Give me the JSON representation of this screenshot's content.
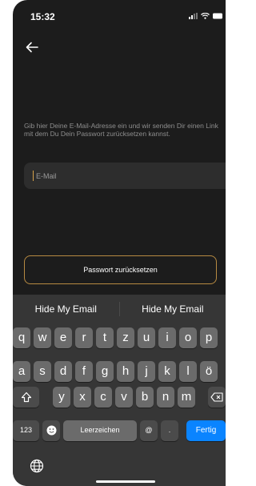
{
  "status_bar": {
    "time": "15:32"
  },
  "screen": {
    "description": "Gib hier Deine E-Mail-Adresse ein und wir senden Dir einen Link mit dem Du Dein Passwort zurücksetzen kannst.",
    "email_placeholder": "E-Mail",
    "reset_button_label": "Passwort zurücksetzen"
  },
  "keyboard": {
    "suggestions": [
      "Hide My Email",
      "Hide My Email"
    ],
    "row1": [
      "q",
      "w",
      "e",
      "r",
      "t",
      "z",
      "u",
      "i",
      "o",
      "p"
    ],
    "row2": [
      "a",
      "s",
      "d",
      "f",
      "g",
      "h",
      "j",
      "k",
      "l",
      "ö"
    ],
    "row3": [
      "y",
      "x",
      "c",
      "v",
      "b",
      "n",
      "m"
    ],
    "numbers_key": "123",
    "space_label": "Leerzeichen",
    "at_key": "@",
    "dot_key": ".",
    "return_label": "Fertig"
  },
  "colors": {
    "accent": "#b78a42",
    "return_key": "#0a84ff"
  }
}
